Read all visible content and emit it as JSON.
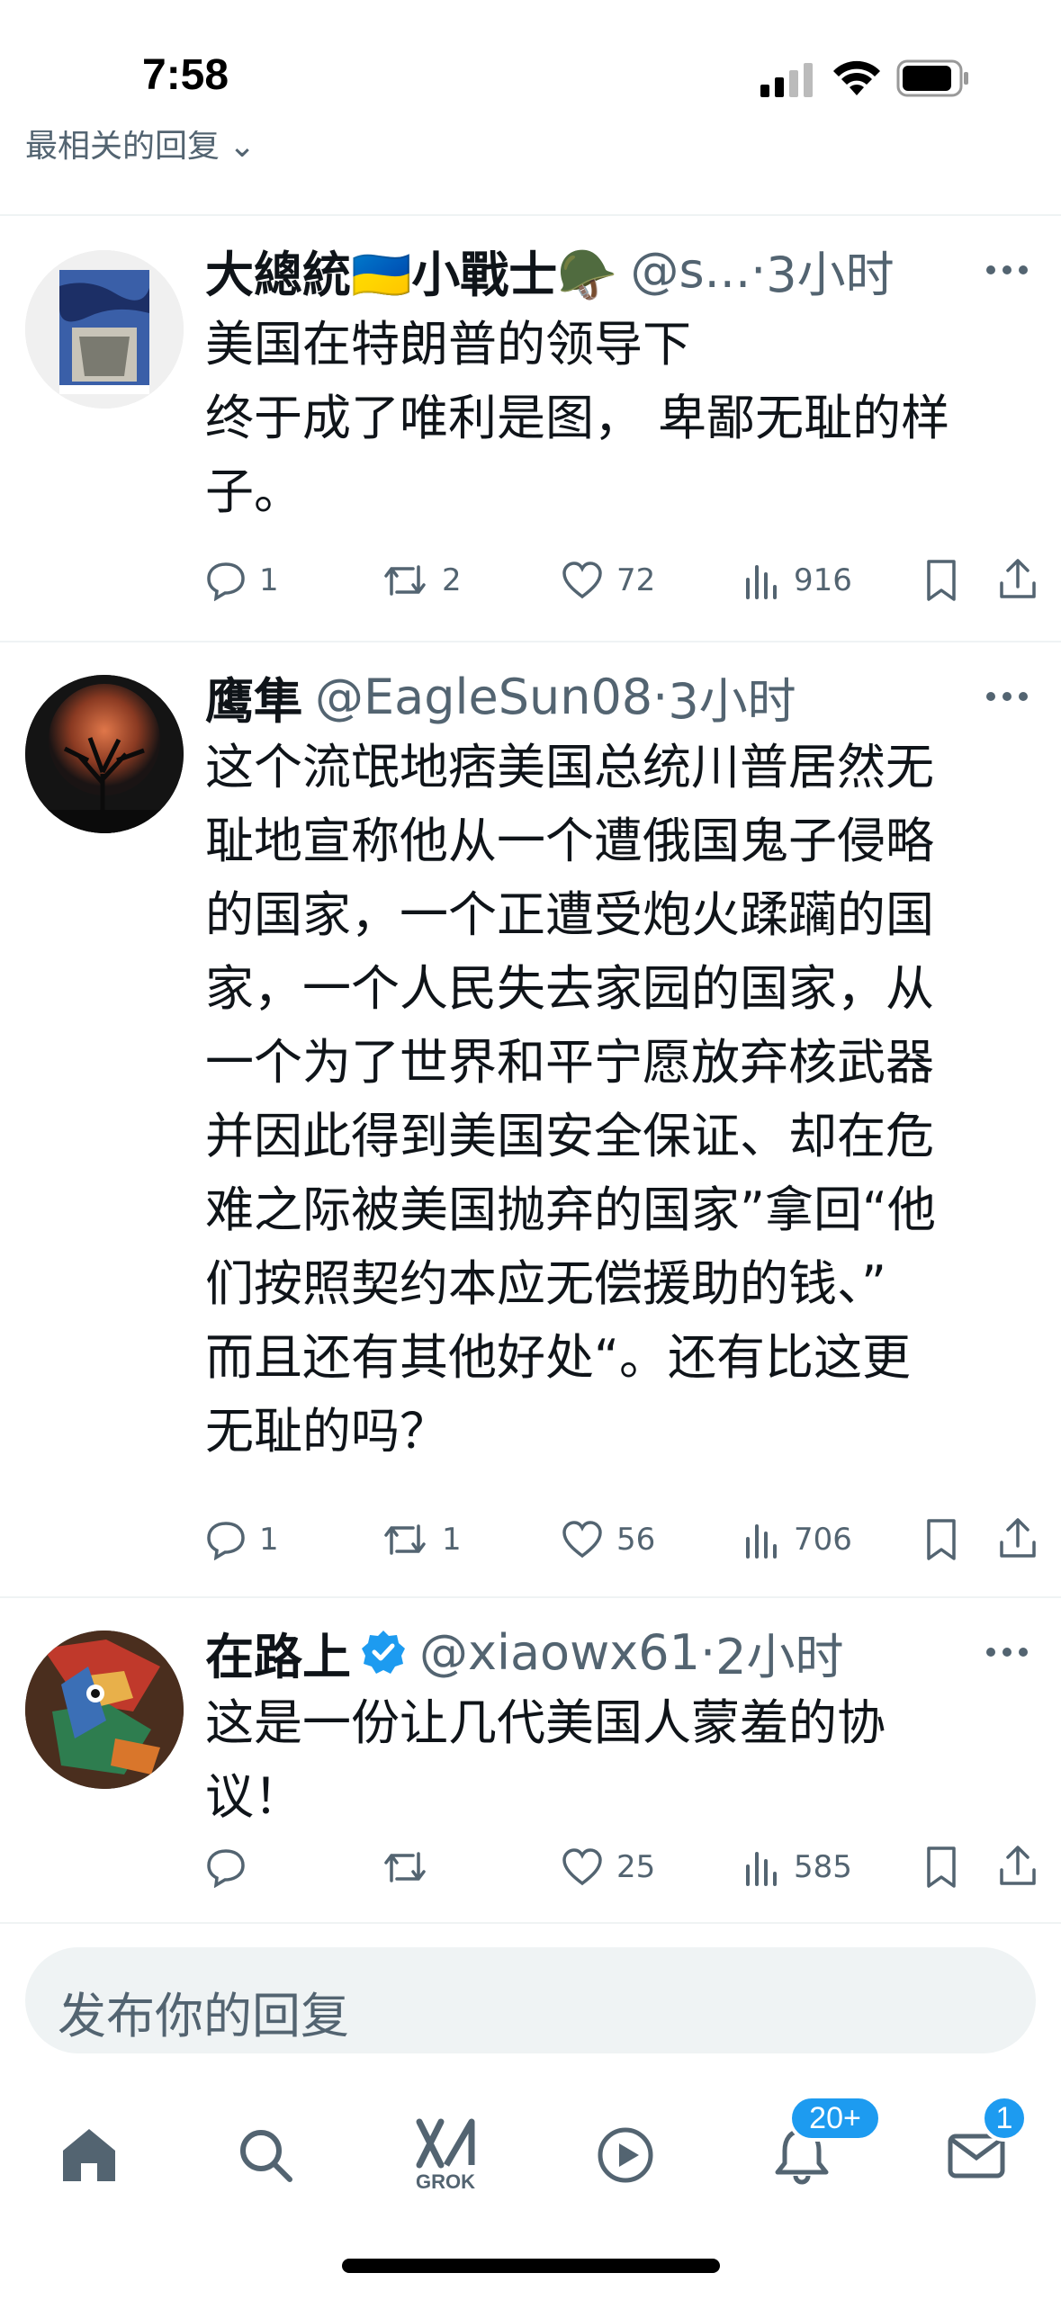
{
  "status_bar": {
    "time": "7:58"
  },
  "sort_label": "最相关的回复",
  "tweets": [
    {
      "name": "大總統🇺🇦小戰士🪖",
      "handle": "@s...",
      "dot": "·",
      "time": "3小时",
      "text": "美国在特朗普的领导下\n终于成了唯利是图， 卑鄙无耻的样\n子。",
      "replies": "1",
      "reposts": "2",
      "likes": "72",
      "views": "916"
    },
    {
      "name": "鹰隼",
      "handle": "@EagleSun08",
      "dot": "·",
      "time": "3小时",
      "text": "这个流氓地痞美国总统川普居然无\n耻地宣称他从一个遭俄国鬼子侵略\n的国家，一个正遭受炮火蹂躏的国\n家，一个人民失去家园的国家，从\n一个为了世界和平宁愿放弃核武器\n并因此得到美国安全保证、却在危\n难之际被美国抛弃的国家”拿回“他\n们按照契约本应无偿援助的钱、”\n而且还有其他好处“。还有比这更\n无耻的吗？",
      "replies": "1",
      "reposts": "1",
      "likes": "56",
      "views": "706"
    },
    {
      "name": "在路上",
      "handle": "@xiaowx61",
      "dot": "·",
      "time": "2小时",
      "text": "这是一份让几代美国人蒙羞的协\n议！",
      "replies": "",
      "reposts": "",
      "likes": "25",
      "views": "585"
    }
  ],
  "reply_placeholder": "发布你的回复",
  "tabbar": {
    "grok_label": "GROK",
    "notifications_badge": "20+",
    "messages_badge": "1"
  },
  "colors": {
    "accent": "#1d9bf0",
    "muted": "#536471",
    "text": "#0f1419"
  }
}
